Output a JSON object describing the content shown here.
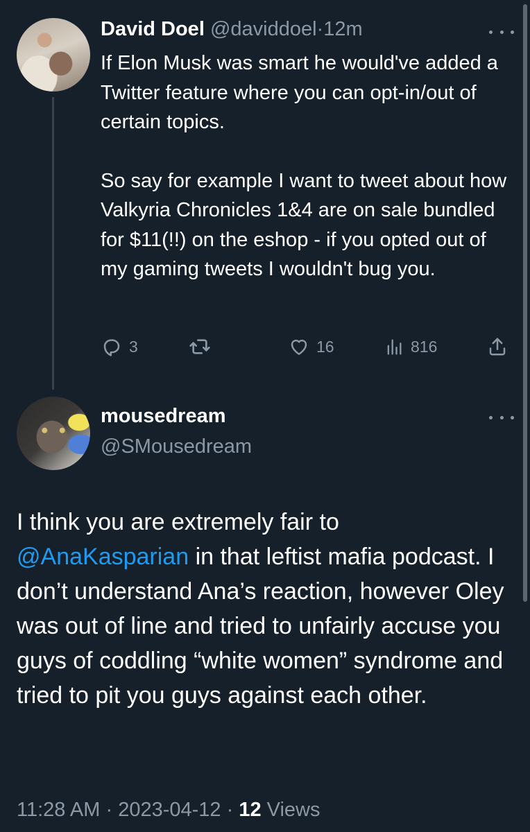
{
  "parent_tweet": {
    "display_name": "David Doel",
    "handle": "@daviddoel",
    "separator": "·",
    "time": "12m",
    "paragraph1": "If Elon Musk was smart he would've added a Twitter feature where you can opt-in/out of certain topics.",
    "paragraph2": "So say for example I want to tweet about how Valkyria Chronicles 1&4 are on sale bundled for $11(!!) on the eshop - if you opted out of my gaming tweets I wouldn't bug you.",
    "actions": {
      "reply_count": "3",
      "retweet_count": "",
      "like_count": "16",
      "views_count": "816"
    }
  },
  "focused_tweet": {
    "display_name": "mousedream",
    "handle": "@SMousedream",
    "text_before_mention": "I think you are extremely fair to ",
    "mention": "@AnaKasparian",
    "text_after_mention": " in that leftist mafia podcast. I don’t understand Ana’s reaction, however Oley was out of line and tried to unfairly accuse you guys of coddling “white women” syndrome and tried to pit you guys against each other.",
    "footer": {
      "time": "11:28 AM",
      "sep1": "·",
      "date": "2023-04-12",
      "sep2": "·",
      "views_number": "12",
      "views_label": "Views"
    }
  },
  "icons": {
    "reply": "reply-icon",
    "retweet": "retweet-icon",
    "like": "heart-icon",
    "views": "views-chart-icon",
    "share": "share-icon",
    "more": "more-icon"
  },
  "colors": {
    "background": "#15202b",
    "text": "#ffffff",
    "muted": "#8b98a5",
    "link": "#1d9bf0",
    "thread_line": "#38444d"
  }
}
